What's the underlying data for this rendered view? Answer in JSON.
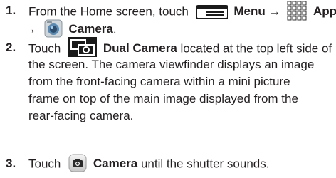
{
  "steps": [
    {
      "number": "1.",
      "prefix": "From the Home screen, touch",
      "menu_label": "Menu",
      "arrow1": "→",
      "apps_label": "Apps",
      "arrow2": "→",
      "camera_label": "Camera",
      "suffix": ".",
      "icons": [
        "menu-icon",
        "apps-grid-icon",
        "camera-app-icon"
      ]
    },
    {
      "number": "2.",
      "prefix": "Touch",
      "dual_label": "Dual Camera",
      "line1_rest": "located at the top left side of",
      "line2": "the screen. The camera viewfinder displays an image",
      "line3": "from the front-facing camera within a mini picture",
      "line4": "frame on top of the main image displayed from the",
      "line5": "rear-facing camera.",
      "icons": [
        "dual-camera-icon"
      ]
    },
    {
      "number": "3.",
      "prefix": "Touch",
      "camera_label": "Camera",
      "suffix": "until the shutter sounds.",
      "icons": [
        "shutter-button-icon"
      ]
    }
  ],
  "colors": {
    "text": "#231f20",
    "icon_dark": "#1a1a1a"
  }
}
